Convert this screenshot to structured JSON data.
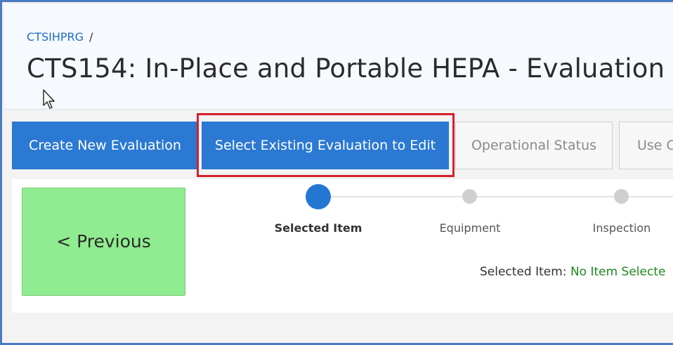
{
  "breadcrumb": {
    "root": "CTSIHPRG",
    "separator": "/"
  },
  "page_title": "CTS154: In-Place and Portable HEPA - Evaluation",
  "tabs": [
    {
      "label": "Create New Evaluation",
      "active": true
    },
    {
      "label": "Select Existing Evaluation to Edit",
      "active": true
    },
    {
      "label": "Operational Status",
      "active": false
    },
    {
      "label": "Use C",
      "active": false
    }
  ],
  "previous_button": {
    "label": "< Previous"
  },
  "steps": [
    {
      "label": "Selected Item",
      "active": true
    },
    {
      "label": "Equipment",
      "active": false
    },
    {
      "label": "Inspection",
      "active": false
    }
  ],
  "selected_item": {
    "label": "Selected Item:",
    "value": "No Item Selecte"
  },
  "colors": {
    "primary": "#2b79d3",
    "highlight_border": "#d6202a",
    "previous_bg": "#90ec90",
    "selected_value": "#1d8a1d"
  }
}
